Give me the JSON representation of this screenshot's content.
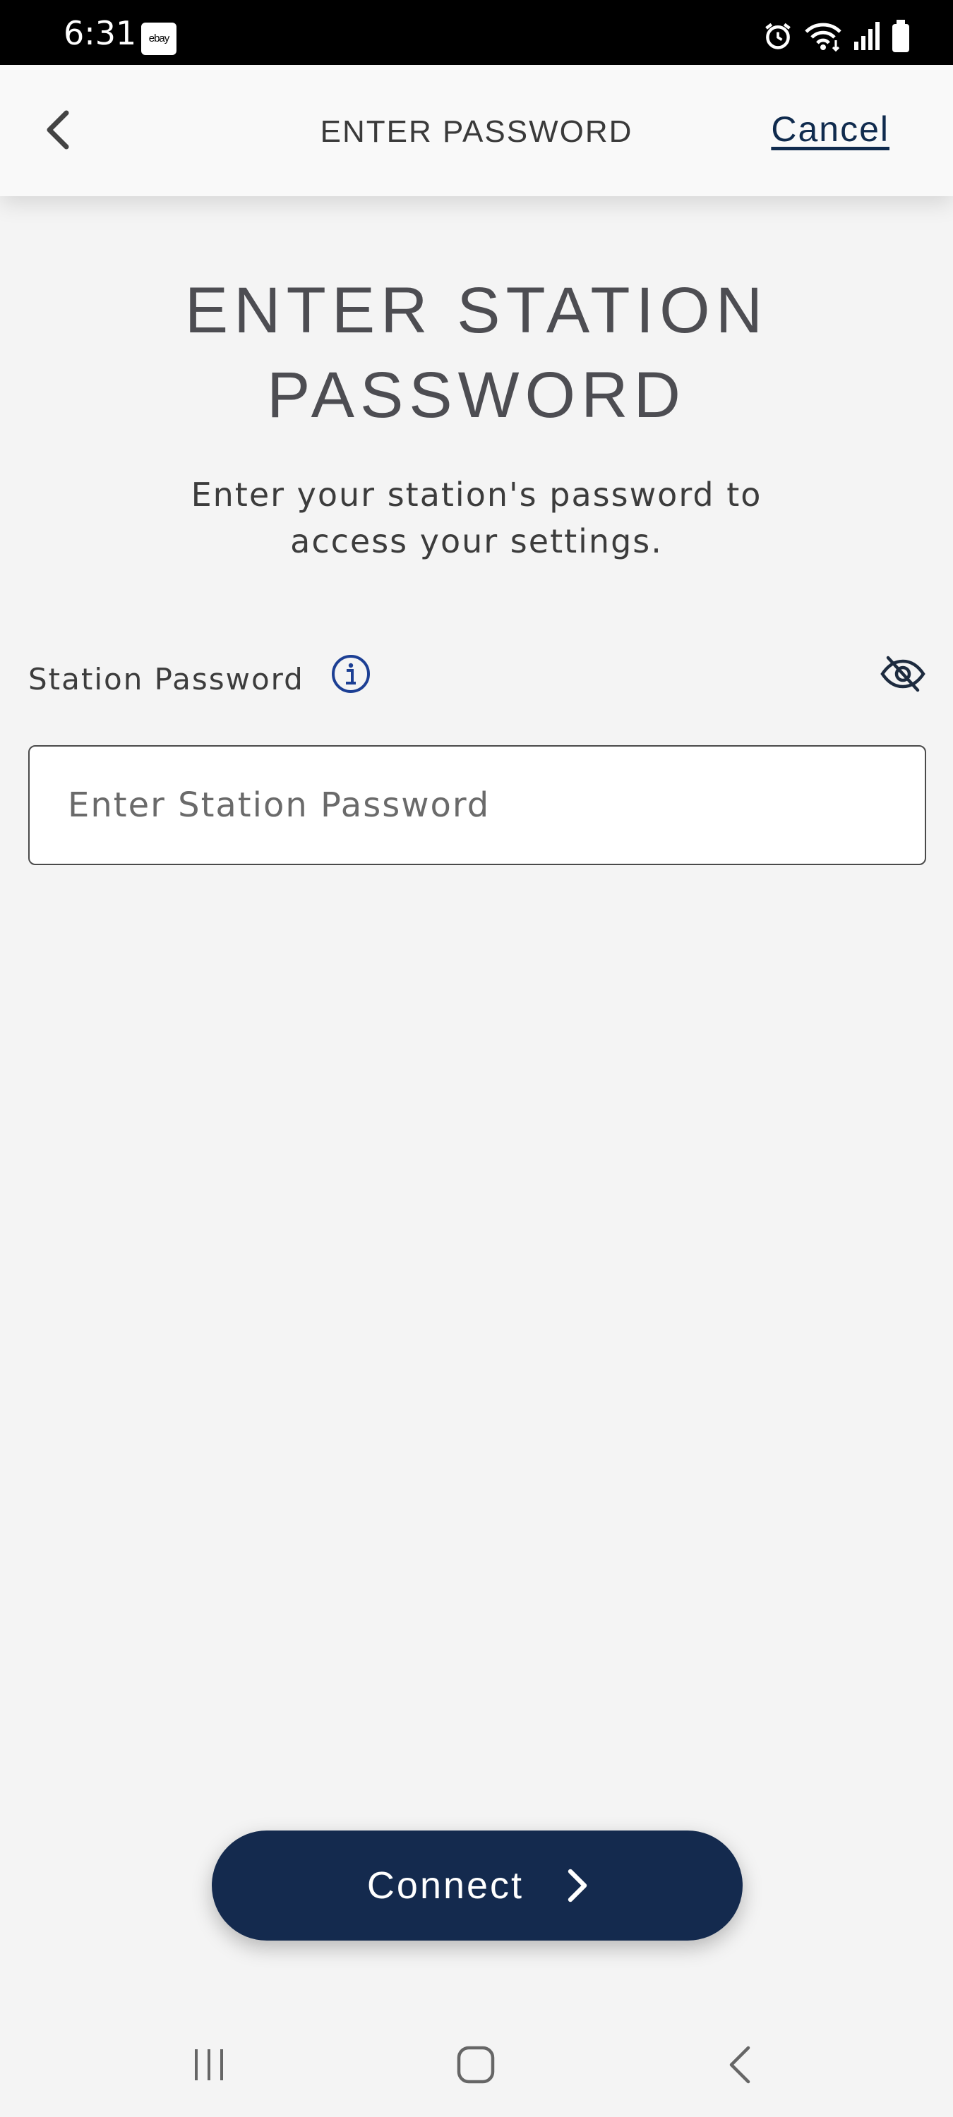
{
  "status_bar": {
    "time": "6:31",
    "app_badge": "ebay",
    "icons": [
      "alarm-icon",
      "wifi-icon",
      "signal-icon",
      "battery-icon"
    ]
  },
  "header": {
    "title": "ENTER PASSWORD",
    "cancel_label": "Cancel"
  },
  "main": {
    "title": "ENTER STATION PASSWORD",
    "subtitle": "Enter your station's password to access your settings.",
    "field": {
      "label": "Station Password",
      "placeholder": "Enter Station Password",
      "value": ""
    },
    "connect_label": "Connect"
  },
  "colors": {
    "primary": "#142a4e",
    "info_blue": "#1c3f94",
    "background": "#f4f4f4"
  }
}
